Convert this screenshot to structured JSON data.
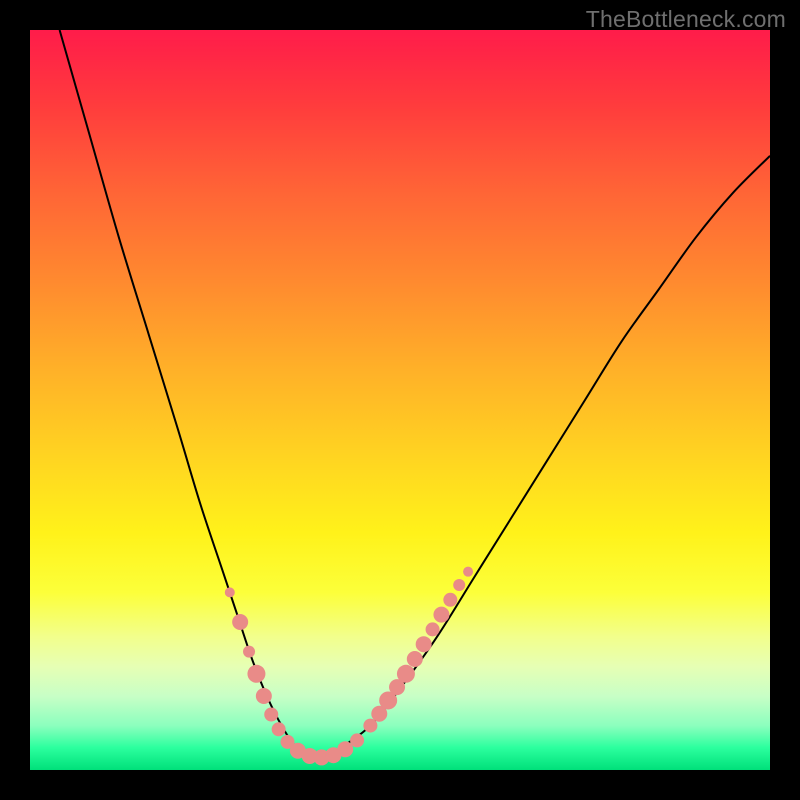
{
  "watermark": "TheBottleneck.com",
  "chart_data": {
    "type": "line",
    "title": "",
    "xlabel": "",
    "ylabel": "",
    "xlim": [
      0,
      100
    ],
    "ylim": [
      0,
      100
    ],
    "series": [
      {
        "name": "bottleneck-curve",
        "color": "#000000",
        "x": [
          4,
          8,
          12,
          16,
          20,
          23,
          26,
          28,
          30,
          32,
          34,
          36,
          38,
          40,
          42,
          46,
          50,
          55,
          60,
          65,
          70,
          75,
          80,
          85,
          90,
          95,
          100
        ],
        "y": [
          100,
          86,
          72,
          59,
          46,
          36,
          27,
          21,
          15,
          10,
          6,
          3,
          2,
          2,
          3,
          6,
          11,
          18,
          26,
          34,
          42,
          50,
          58,
          65,
          72,
          78,
          83
        ]
      }
    ],
    "markers": [
      {
        "name": "left-branch-dots",
        "color": "#e98b88",
        "points": [
          {
            "x": 27.0,
            "y": 24.0,
            "r": 5
          },
          {
            "x": 28.4,
            "y": 20.0,
            "r": 8
          },
          {
            "x": 29.6,
            "y": 16.0,
            "r": 6
          },
          {
            "x": 30.6,
            "y": 13.0,
            "r": 9
          },
          {
            "x": 31.6,
            "y": 10.0,
            "r": 8
          },
          {
            "x": 32.6,
            "y": 7.5,
            "r": 7
          },
          {
            "x": 33.6,
            "y": 5.5,
            "r": 7
          }
        ]
      },
      {
        "name": "trough-dots",
        "color": "#e98b88",
        "points": [
          {
            "x": 34.8,
            "y": 3.8,
            "r": 7
          },
          {
            "x": 36.2,
            "y": 2.6,
            "r": 8
          },
          {
            "x": 37.8,
            "y": 1.9,
            "r": 8
          },
          {
            "x": 39.4,
            "y": 1.7,
            "r": 8
          },
          {
            "x": 41.0,
            "y": 2.0,
            "r": 8
          },
          {
            "x": 42.6,
            "y": 2.8,
            "r": 8
          },
          {
            "x": 44.2,
            "y": 4.0,
            "r": 7
          }
        ]
      },
      {
        "name": "right-branch-dots",
        "color": "#e98b88",
        "points": [
          {
            "x": 46.0,
            "y": 6.0,
            "r": 7
          },
          {
            "x": 47.2,
            "y": 7.6,
            "r": 8
          },
          {
            "x": 48.4,
            "y": 9.4,
            "r": 9
          },
          {
            "x": 49.6,
            "y": 11.2,
            "r": 8
          },
          {
            "x": 50.8,
            "y": 13.0,
            "r": 9
          },
          {
            "x": 52.0,
            "y": 15.0,
            "r": 8
          },
          {
            "x": 53.2,
            "y": 17.0,
            "r": 8
          },
          {
            "x": 54.4,
            "y": 19.0,
            "r": 7
          },
          {
            "x": 55.6,
            "y": 21.0,
            "r": 8
          },
          {
            "x": 56.8,
            "y": 23.0,
            "r": 7
          },
          {
            "x": 58.0,
            "y": 25.0,
            "r": 6
          },
          {
            "x": 59.2,
            "y": 26.8,
            "r": 5
          }
        ]
      }
    ]
  }
}
